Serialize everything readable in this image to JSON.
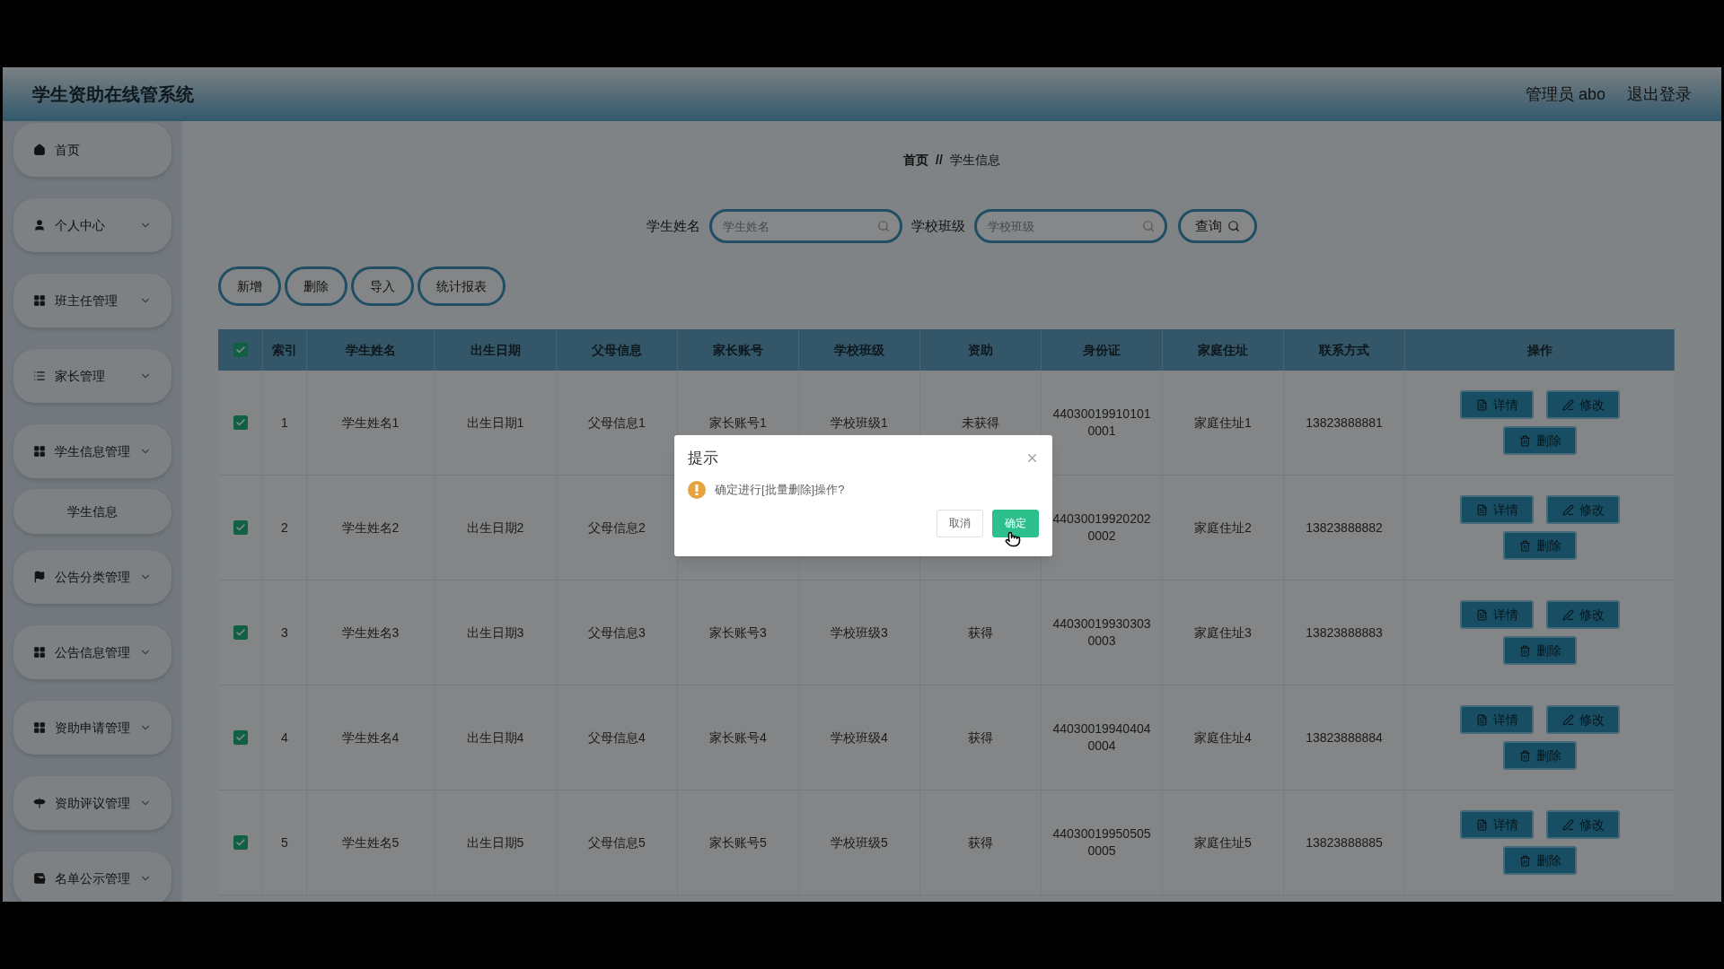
{
  "header": {
    "title": "学生资助在线管系统",
    "user": "管理员 abo",
    "logout": "退出登录"
  },
  "sidebar": {
    "items": [
      {
        "label": "首页",
        "kind": "link"
      },
      {
        "label": "个人中心",
        "kind": "menu"
      },
      {
        "label": "班主任管理",
        "kind": "menu"
      },
      {
        "label": "家长管理",
        "kind": "menu"
      },
      {
        "label": "学生信息管理",
        "kind": "menu",
        "children": [
          {
            "label": "学生信息"
          }
        ]
      },
      {
        "label": "公告分类管理",
        "kind": "menu"
      },
      {
        "label": "公告信息管理",
        "kind": "menu"
      },
      {
        "label": "资助申请管理",
        "kind": "menu"
      },
      {
        "label": "资助评议管理",
        "kind": "menu"
      },
      {
        "label": "名单公示管理",
        "kind": "menu"
      }
    ]
  },
  "breadcrumb": [
    "首页",
    "//",
    "学生信息"
  ],
  "search": {
    "fields": [
      {
        "label": "学生姓名",
        "placeholder": "学生姓名"
      },
      {
        "label": "学校班级",
        "placeholder": "学校班级"
      }
    ],
    "button": "查询"
  },
  "actions": [
    "新增",
    "删除",
    "导入",
    "统计报表"
  ],
  "table": {
    "all_checked": true,
    "columns": [
      "索引",
      "学生姓名",
      "出生日期",
      "父母信息",
      "家长账号",
      "学校班级",
      "资助",
      "身份证",
      "家庭住址",
      "联系方式",
      "操作"
    ],
    "rows": [
      {
        "checked": true,
        "cells": [
          "1",
          "学生姓名1",
          "出生日期1",
          "父母信息1",
          "家长账号1",
          "学校班级1",
          "未获得",
          "440300199101010001",
          "家庭住址1",
          "13823888881"
        ],
        "buttons": [
          "详情",
          "修改",
          "删除"
        ]
      },
      {
        "checked": true,
        "cells": [
          "2",
          "学生姓名2",
          "出生日期2",
          "父母信息2",
          null,
          null,
          null,
          "440300199202020002",
          "家庭住址2",
          "13823888882"
        ],
        "buttons": [
          "详情",
          "修改",
          "删除"
        ]
      },
      {
        "checked": true,
        "cells": [
          "3",
          "学生姓名3",
          "出生日期3",
          "父母信息3",
          "家长账号3",
          "学校班级3",
          "获得",
          "440300199303030003",
          "家庭住址3",
          "13823888883"
        ],
        "buttons": [
          "详情",
          "修改",
          "删除"
        ]
      },
      {
        "checked": true,
        "cells": [
          "4",
          "学生姓名4",
          "出生日期4",
          "父母信息4",
          "家长账号4",
          "学校班级4",
          "获得",
          "440300199404040004",
          "家庭住址4",
          "13823888884"
        ],
        "buttons": [
          "详情",
          "修改",
          "删除"
        ]
      },
      {
        "checked": true,
        "cells": [
          "5",
          "学生姓名5",
          "出生日期5",
          "父母信息5",
          "家长账号5",
          "学校班级5",
          "获得",
          "440300199505050005",
          "家庭住址5",
          "13823888885"
        ],
        "buttons": [
          "详情",
          "修改",
          "删除"
        ]
      }
    ]
  },
  "dialog": {
    "title": "提示",
    "message": "确定进行[批量删除]操作?",
    "buttons": [
      {
        "label": "取消",
        "kind": "secondary"
      },
      {
        "label": "确定",
        "kind": "primary"
      }
    ]
  }
}
